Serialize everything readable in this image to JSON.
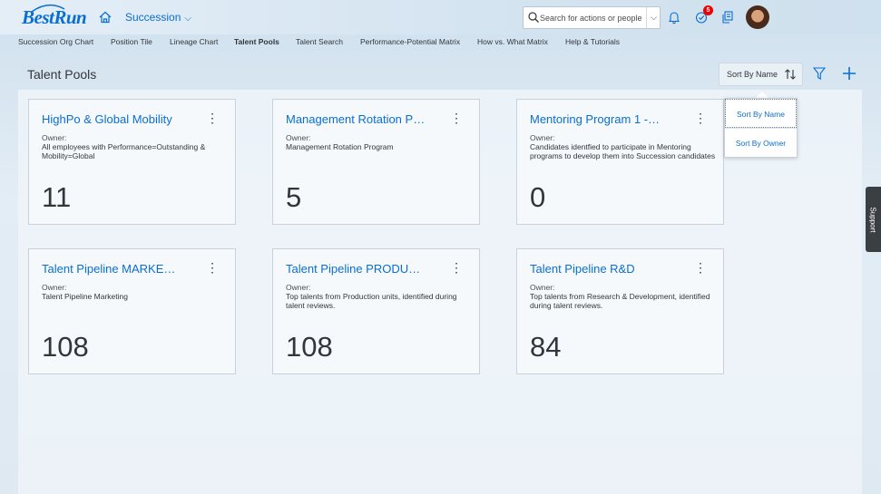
{
  "shell": {
    "logo": "BestRun",
    "module": "Succession",
    "search_placeholder": "Search for actions or people",
    "notification_badge": "5",
    "icons": [
      "home-icon",
      "bell-icon",
      "approvals-icon",
      "tools-icon",
      "search-icon",
      "chevron-down-icon"
    ]
  },
  "subnav": {
    "items": [
      {
        "label": "Succession Org Chart"
      },
      {
        "label": "Position Tile"
      },
      {
        "label": "Lineage Chart"
      },
      {
        "label": "Talent Pools",
        "active": true
      },
      {
        "label": "Talent Search"
      },
      {
        "label": "Performance-Potential Matrix"
      },
      {
        "label": "How vs. What Matrix"
      },
      {
        "label": "Help & Tutorials"
      }
    ]
  },
  "page": {
    "title": "Talent Pools",
    "sort_label": "Sort By Name"
  },
  "sort_menu": {
    "options": [
      "Sort By Name",
      "Sort By Owner"
    ]
  },
  "cards": [
    {
      "title": "HighPo & Global Mobility",
      "owner_label": "Owner:",
      "owner": "All employees with Performance=Outstanding & Mobility=Global",
      "count": "11"
    },
    {
      "title": "Management Rotation P…",
      "owner_label": "Owner:",
      "owner": "Management Rotation Program",
      "count": "5"
    },
    {
      "title": "Mentoring Program 1 -…",
      "owner_label": "Owner:",
      "owner": "Candidates identfied to participate in Mentoring programs to develop them into Succession candidates",
      "count": "0"
    },
    {
      "title": "Talent Pipeline MARKE…",
      "owner_label": "Owner:",
      "owner": "Talent Pipeline Marketing",
      "count": "108"
    },
    {
      "title": "Talent Pipeline PRODU…",
      "owner_label": "Owner:",
      "owner": "Top talents from Production units, identified during talent reviews.",
      "count": "108"
    },
    {
      "title": "Talent Pipeline R&D",
      "owner_label": "Owner:",
      "owner": "Top talents from Research & Development, identified during talent reviews.",
      "count": "84"
    }
  ],
  "card_menu_glyph": "⋮",
  "support": "Support",
  "colors": {
    "accent": "#0a6ed1",
    "badge": "#e00000"
  }
}
